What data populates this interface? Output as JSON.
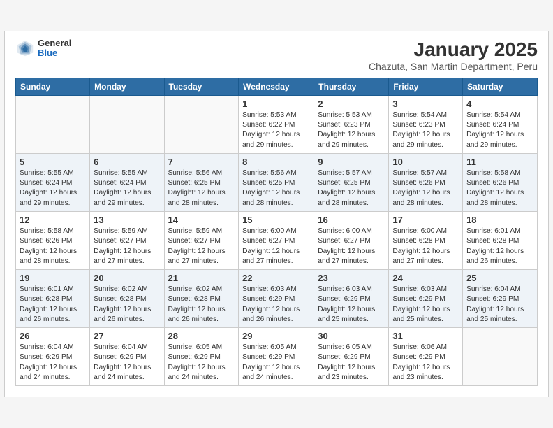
{
  "logo": {
    "general": "General",
    "blue": "Blue"
  },
  "header": {
    "title": "January 2025",
    "subtitle": "Chazuta, San Martin Department, Peru"
  },
  "weekdays": [
    "Sunday",
    "Monday",
    "Tuesday",
    "Wednesday",
    "Thursday",
    "Friday",
    "Saturday"
  ],
  "weeks": [
    [
      {
        "day": null,
        "info": null
      },
      {
        "day": null,
        "info": null
      },
      {
        "day": null,
        "info": null
      },
      {
        "day": "1",
        "info": "Sunrise: 5:53 AM\nSunset: 6:22 PM\nDaylight: 12 hours\nand 29 minutes."
      },
      {
        "day": "2",
        "info": "Sunrise: 5:53 AM\nSunset: 6:23 PM\nDaylight: 12 hours\nand 29 minutes."
      },
      {
        "day": "3",
        "info": "Sunrise: 5:54 AM\nSunset: 6:23 PM\nDaylight: 12 hours\nand 29 minutes."
      },
      {
        "day": "4",
        "info": "Sunrise: 5:54 AM\nSunset: 6:24 PM\nDaylight: 12 hours\nand 29 minutes."
      }
    ],
    [
      {
        "day": "5",
        "info": "Sunrise: 5:55 AM\nSunset: 6:24 PM\nDaylight: 12 hours\nand 29 minutes."
      },
      {
        "day": "6",
        "info": "Sunrise: 5:55 AM\nSunset: 6:24 PM\nDaylight: 12 hours\nand 29 minutes."
      },
      {
        "day": "7",
        "info": "Sunrise: 5:56 AM\nSunset: 6:25 PM\nDaylight: 12 hours\nand 28 minutes."
      },
      {
        "day": "8",
        "info": "Sunrise: 5:56 AM\nSunset: 6:25 PM\nDaylight: 12 hours\nand 28 minutes."
      },
      {
        "day": "9",
        "info": "Sunrise: 5:57 AM\nSunset: 6:25 PM\nDaylight: 12 hours\nand 28 minutes."
      },
      {
        "day": "10",
        "info": "Sunrise: 5:57 AM\nSunset: 6:26 PM\nDaylight: 12 hours\nand 28 minutes."
      },
      {
        "day": "11",
        "info": "Sunrise: 5:58 AM\nSunset: 6:26 PM\nDaylight: 12 hours\nand 28 minutes."
      }
    ],
    [
      {
        "day": "12",
        "info": "Sunrise: 5:58 AM\nSunset: 6:26 PM\nDaylight: 12 hours\nand 28 minutes."
      },
      {
        "day": "13",
        "info": "Sunrise: 5:59 AM\nSunset: 6:27 PM\nDaylight: 12 hours\nand 27 minutes."
      },
      {
        "day": "14",
        "info": "Sunrise: 5:59 AM\nSunset: 6:27 PM\nDaylight: 12 hours\nand 27 minutes."
      },
      {
        "day": "15",
        "info": "Sunrise: 6:00 AM\nSunset: 6:27 PM\nDaylight: 12 hours\nand 27 minutes."
      },
      {
        "day": "16",
        "info": "Sunrise: 6:00 AM\nSunset: 6:27 PM\nDaylight: 12 hours\nand 27 minutes."
      },
      {
        "day": "17",
        "info": "Sunrise: 6:00 AM\nSunset: 6:28 PM\nDaylight: 12 hours\nand 27 minutes."
      },
      {
        "day": "18",
        "info": "Sunrise: 6:01 AM\nSunset: 6:28 PM\nDaylight: 12 hours\nand 26 minutes."
      }
    ],
    [
      {
        "day": "19",
        "info": "Sunrise: 6:01 AM\nSunset: 6:28 PM\nDaylight: 12 hours\nand 26 minutes."
      },
      {
        "day": "20",
        "info": "Sunrise: 6:02 AM\nSunset: 6:28 PM\nDaylight: 12 hours\nand 26 minutes."
      },
      {
        "day": "21",
        "info": "Sunrise: 6:02 AM\nSunset: 6:28 PM\nDaylight: 12 hours\nand 26 minutes."
      },
      {
        "day": "22",
        "info": "Sunrise: 6:03 AM\nSunset: 6:29 PM\nDaylight: 12 hours\nand 26 minutes."
      },
      {
        "day": "23",
        "info": "Sunrise: 6:03 AM\nSunset: 6:29 PM\nDaylight: 12 hours\nand 25 minutes."
      },
      {
        "day": "24",
        "info": "Sunrise: 6:03 AM\nSunset: 6:29 PM\nDaylight: 12 hours\nand 25 minutes."
      },
      {
        "day": "25",
        "info": "Sunrise: 6:04 AM\nSunset: 6:29 PM\nDaylight: 12 hours\nand 25 minutes."
      }
    ],
    [
      {
        "day": "26",
        "info": "Sunrise: 6:04 AM\nSunset: 6:29 PM\nDaylight: 12 hours\nand 24 minutes."
      },
      {
        "day": "27",
        "info": "Sunrise: 6:04 AM\nSunset: 6:29 PM\nDaylight: 12 hours\nand 24 minutes."
      },
      {
        "day": "28",
        "info": "Sunrise: 6:05 AM\nSunset: 6:29 PM\nDaylight: 12 hours\nand 24 minutes."
      },
      {
        "day": "29",
        "info": "Sunrise: 6:05 AM\nSunset: 6:29 PM\nDaylight: 12 hours\nand 24 minutes."
      },
      {
        "day": "30",
        "info": "Sunrise: 6:05 AM\nSunset: 6:29 PM\nDaylight: 12 hours\nand 23 minutes."
      },
      {
        "day": "31",
        "info": "Sunrise: 6:06 AM\nSunset: 6:29 PM\nDaylight: 12 hours\nand 23 minutes."
      },
      {
        "day": null,
        "info": null
      }
    ]
  ]
}
